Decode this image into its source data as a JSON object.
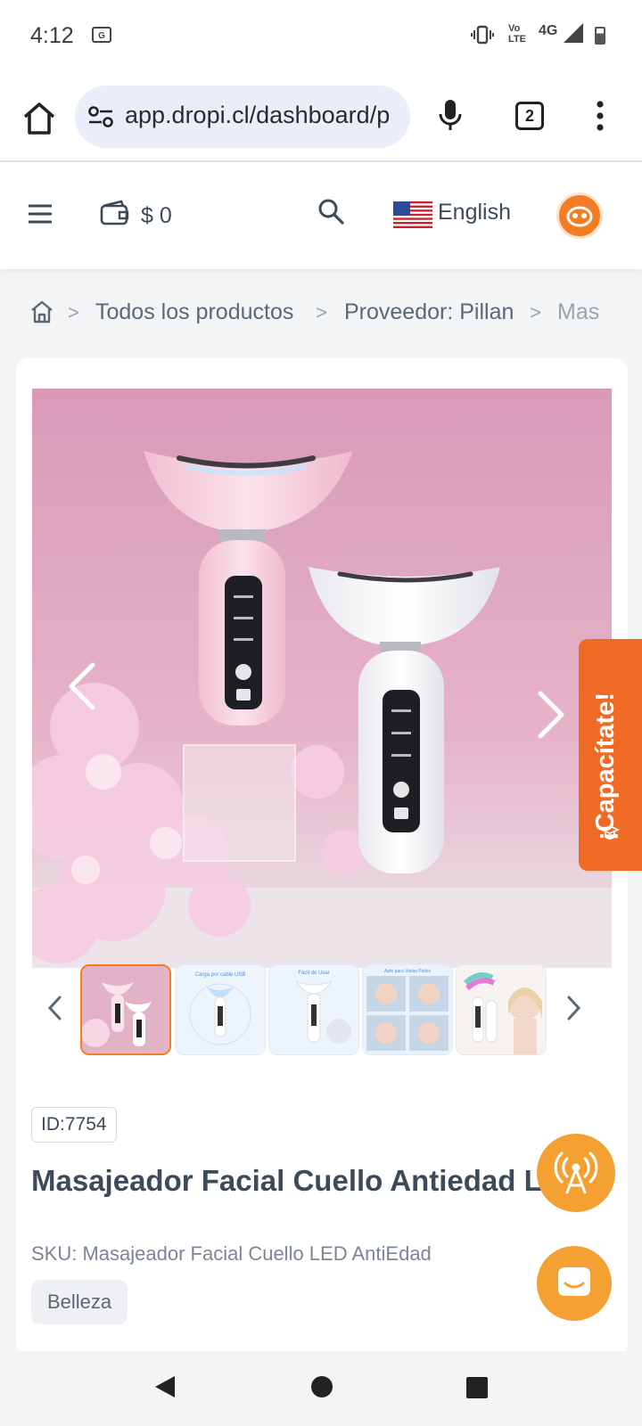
{
  "status_bar": {
    "time": "4:12",
    "sim_badge": "G",
    "volte_label": "Vo LTE",
    "network": "4G"
  },
  "browser": {
    "url": "app.dropi.cl/dashboard/p",
    "tab_count": "2"
  },
  "header": {
    "wallet_amount": "$ 0",
    "language": "English"
  },
  "breadcrumb": {
    "items": [
      "Todos los productos",
      "Proveedor: Pillan",
      "Mas"
    ]
  },
  "capacitate": {
    "label": "¡Capacítate!"
  },
  "product": {
    "id_label": "ID:7754",
    "title": "Masajeador Facial Cuello Antiedad Led",
    "sku": "SKU: Masajeador Facial Cuello LED AntiEdad",
    "category": "Belleza",
    "thumbnail_captions": [
      "",
      "Carga por cable USB",
      "Fácil de Usar",
      "Apto para Varias Pieles",
      ""
    ]
  },
  "colors": {
    "accent": "#f47c22",
    "capacitate_bg": "#ef6b25",
    "fab": "#f5a033",
    "text": "#3c4a5a"
  }
}
